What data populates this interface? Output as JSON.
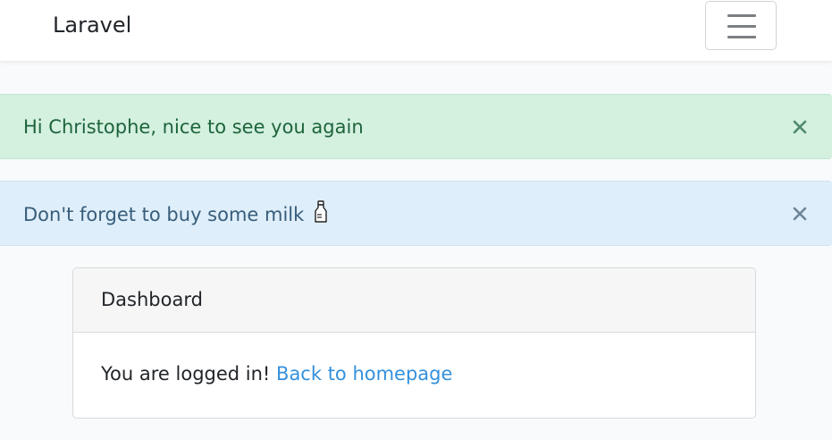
{
  "navbar": {
    "brand": "Laravel",
    "toggler_icon": "hamburger-menu-icon"
  },
  "alerts": [
    {
      "type": "success",
      "message": "Hi Christophe, nice to see you again",
      "close_icon": "close-icon",
      "color": "#d4f0df"
    },
    {
      "type": "info",
      "message": "Don't forget to buy some milk",
      "trailing_icon": "milk-bottle-icon",
      "close_icon": "close-icon",
      "color": "#deeefa"
    }
  ],
  "card": {
    "header": "Dashboard",
    "body_text": "You are logged in!",
    "link_text": "Back to homepage"
  },
  "colors": {
    "link": "#3490dc",
    "page_background": "#f8fafc"
  }
}
